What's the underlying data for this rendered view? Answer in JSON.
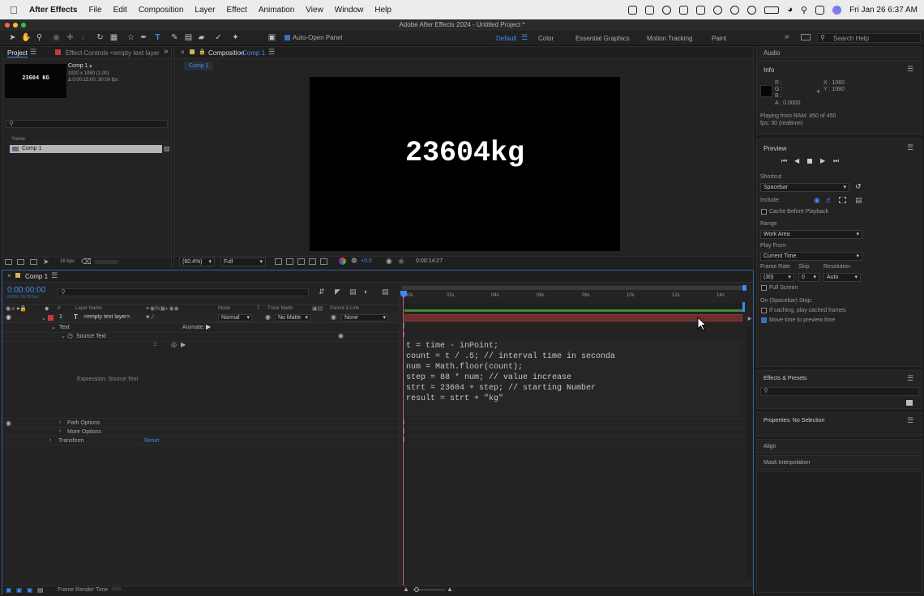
{
  "menubar": {
    "app_name": "After Effects",
    "items": [
      "File",
      "Edit",
      "Composition",
      "Layer",
      "Effect",
      "Animation",
      "View",
      "Window",
      "Help"
    ],
    "datetime": "Fri Jan 26  6:37 AM"
  },
  "window": {
    "title": "Adobe After Effects 2024 - Untitled Project *"
  },
  "toolbar": {
    "auto_open_panel": "Auto-Open Panel",
    "workspaces": [
      "Default",
      "Color",
      "Essential Graphics",
      "Motion Tracking",
      "Paint"
    ],
    "active_workspace": "Default",
    "search_help": "Search Help"
  },
  "project_panel": {
    "tab_label": "Project",
    "effect_controls_tab": "Effect Controls <empty text layer",
    "comp_name": "Comp 1",
    "comp_info_line1": "1920 x 1080 (1.00)",
    "comp_info_line2": "Δ 0:00:15:00, 30.00 fps",
    "thumbnail_text": "23604 KG",
    "name_header": "Name",
    "items": [
      "Comp 1"
    ],
    "bpc": "16 bpc"
  },
  "composition_panel": {
    "tab_label": "Composition",
    "tab_comp": "Comp 1",
    "breadcrumb": "Comp 1",
    "canvas_text": "23604kg",
    "zoom": "(60.4%)",
    "resolution": "Full",
    "exposure": "+0.0",
    "timecode": "0:00:14:27"
  },
  "timeline": {
    "tab_label": "Comp 1",
    "current_time": "0:00:00:00",
    "current_time_sub": "00000 (30.00 fps)",
    "columns": {
      "num": "#",
      "layer_name": "Layer Name",
      "mode": "Mode",
      "t": "T",
      "track_matte": "Track Matte",
      "parent": "Parent & Link"
    },
    "layer": {
      "index": "1",
      "name": "<empty text layer>",
      "mode": "Normal",
      "matte": "No Matte",
      "parent": "None"
    },
    "props": {
      "text": "Text",
      "animate": "Animate:",
      "source_text": "Source Text",
      "expression_label": "Expression: Source Text",
      "path_options": "Path Options",
      "more_options": "More Options",
      "transform": "Transform",
      "reset": "Reset"
    },
    "ruler": [
      "00s",
      "02s",
      "04s",
      "06s",
      "08s",
      "10s",
      "12s",
      "14s"
    ],
    "expression_lines": [
      "t = time - inPoint;",
      "count = t / .5; // interval time in seconda",
      "num = Math.floor(count);",
      "step = 88 * num; // value increase",
      "strt = 23604 + step; // starting Number",
      "result = strt + \"kg\""
    ],
    "footer": "Frame Render Time",
    "footer_value": "1ms"
  },
  "right_panel": {
    "audio": "Audio",
    "info": {
      "title": "Info",
      "r": "R :",
      "g": "G :",
      "b": "B :",
      "a": "A :  0.0000",
      "x": "X : 1060",
      "y": "Y : 1080",
      "status1": "Playing from RAM: 450 of 450",
      "status2": "fps: 30 (realtime)"
    },
    "preview": {
      "title": "Preview",
      "shortcut_label": "Shortcut",
      "shortcut_value": "Spacebar",
      "include_label": "Include:",
      "cache_before": "Cache Before Playback",
      "range_label": "Range",
      "range_value": "Work Area",
      "play_from_label": "Play From",
      "play_from_value": "Current Time",
      "frame_rate_label": "Frame Rate",
      "skip_label": "Skip",
      "resolution_label": "Resolution",
      "frame_rate_value": "(30)",
      "skip_value": "0",
      "resolution_value": "Auto",
      "full_screen": "Full Screen",
      "on_stop_label": "On (Spacebar) Stop:",
      "if_caching": "If caching, play cached frames",
      "move_time": "Move time to preview time"
    },
    "effects_presets": "Effects & Presets",
    "properties": "Properties: No Selection",
    "align": "Align",
    "mask_interpolation": "Mask Interpolation"
  },
  "colors": {
    "accent_blue": "#3d8bf0",
    "layer_bar_red": "#6e2c2c",
    "workarea_green": "#3d8a3a",
    "label_red": "#c73a3a"
  }
}
